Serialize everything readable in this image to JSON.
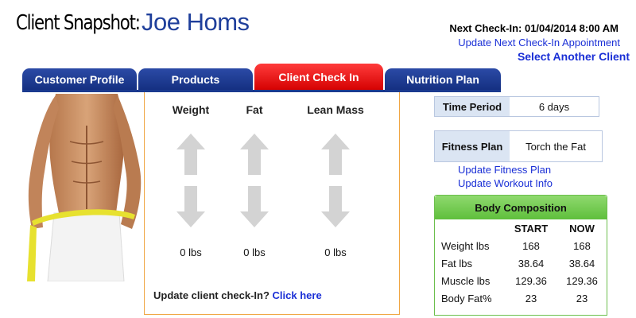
{
  "header": {
    "title_prefix": "Client Snapshot:",
    "client_name": "Joe Homs",
    "next_checkin": "Next Check-In: 01/04/2014 8:00 AM",
    "update_appointment_link": "Update Next Check-In Appointment",
    "select_client_link": "Select Another Client"
  },
  "tabs": [
    {
      "label": "Customer Profile",
      "active": false
    },
    {
      "label": "Products",
      "active": false
    },
    {
      "label": "Client Check In",
      "active": true
    },
    {
      "label": "Nutrition Plan",
      "active": false
    }
  ],
  "checkin": {
    "metrics": [
      {
        "name": "Weight",
        "value": "0  lbs"
      },
      {
        "name": "Fat",
        "value": "0  lbs"
      },
      {
        "name": "Lean Mass",
        "value": "0  lbs"
      }
    ],
    "update_prompt": "Update client check-In?",
    "update_link": "Click here"
  },
  "time_period": {
    "label": "Time Period",
    "value": "6 days"
  },
  "fitness_plan": {
    "label": "Fitness Plan",
    "value": "Torch the Fat"
  },
  "links": {
    "update_fitness_plan": "Update Fitness Plan",
    "update_workout_info": "Update Workout Info"
  },
  "body_composition": {
    "title": "Body Composition",
    "columns": [
      "START",
      "NOW"
    ],
    "rows": [
      {
        "label": "Weight lbs",
        "start": "168",
        "now": "168"
      },
      {
        "label": "Fat lbs",
        "start": "38.64",
        "now": "38.64"
      },
      {
        "label": "Muscle lbs",
        "start": "129.36",
        "now": "129.36"
      },
      {
        "label": "Body Fat%",
        "start": "23",
        "now": "23"
      }
    ]
  },
  "colors": {
    "brand_blue": "#1f3f9b",
    "tab_blue": "#142f80",
    "tab_active_red": "#e00000",
    "link_blue": "#1a2fd6",
    "panel_border_orange": "#f0a643",
    "body_comp_green": "#5fbf3c"
  }
}
